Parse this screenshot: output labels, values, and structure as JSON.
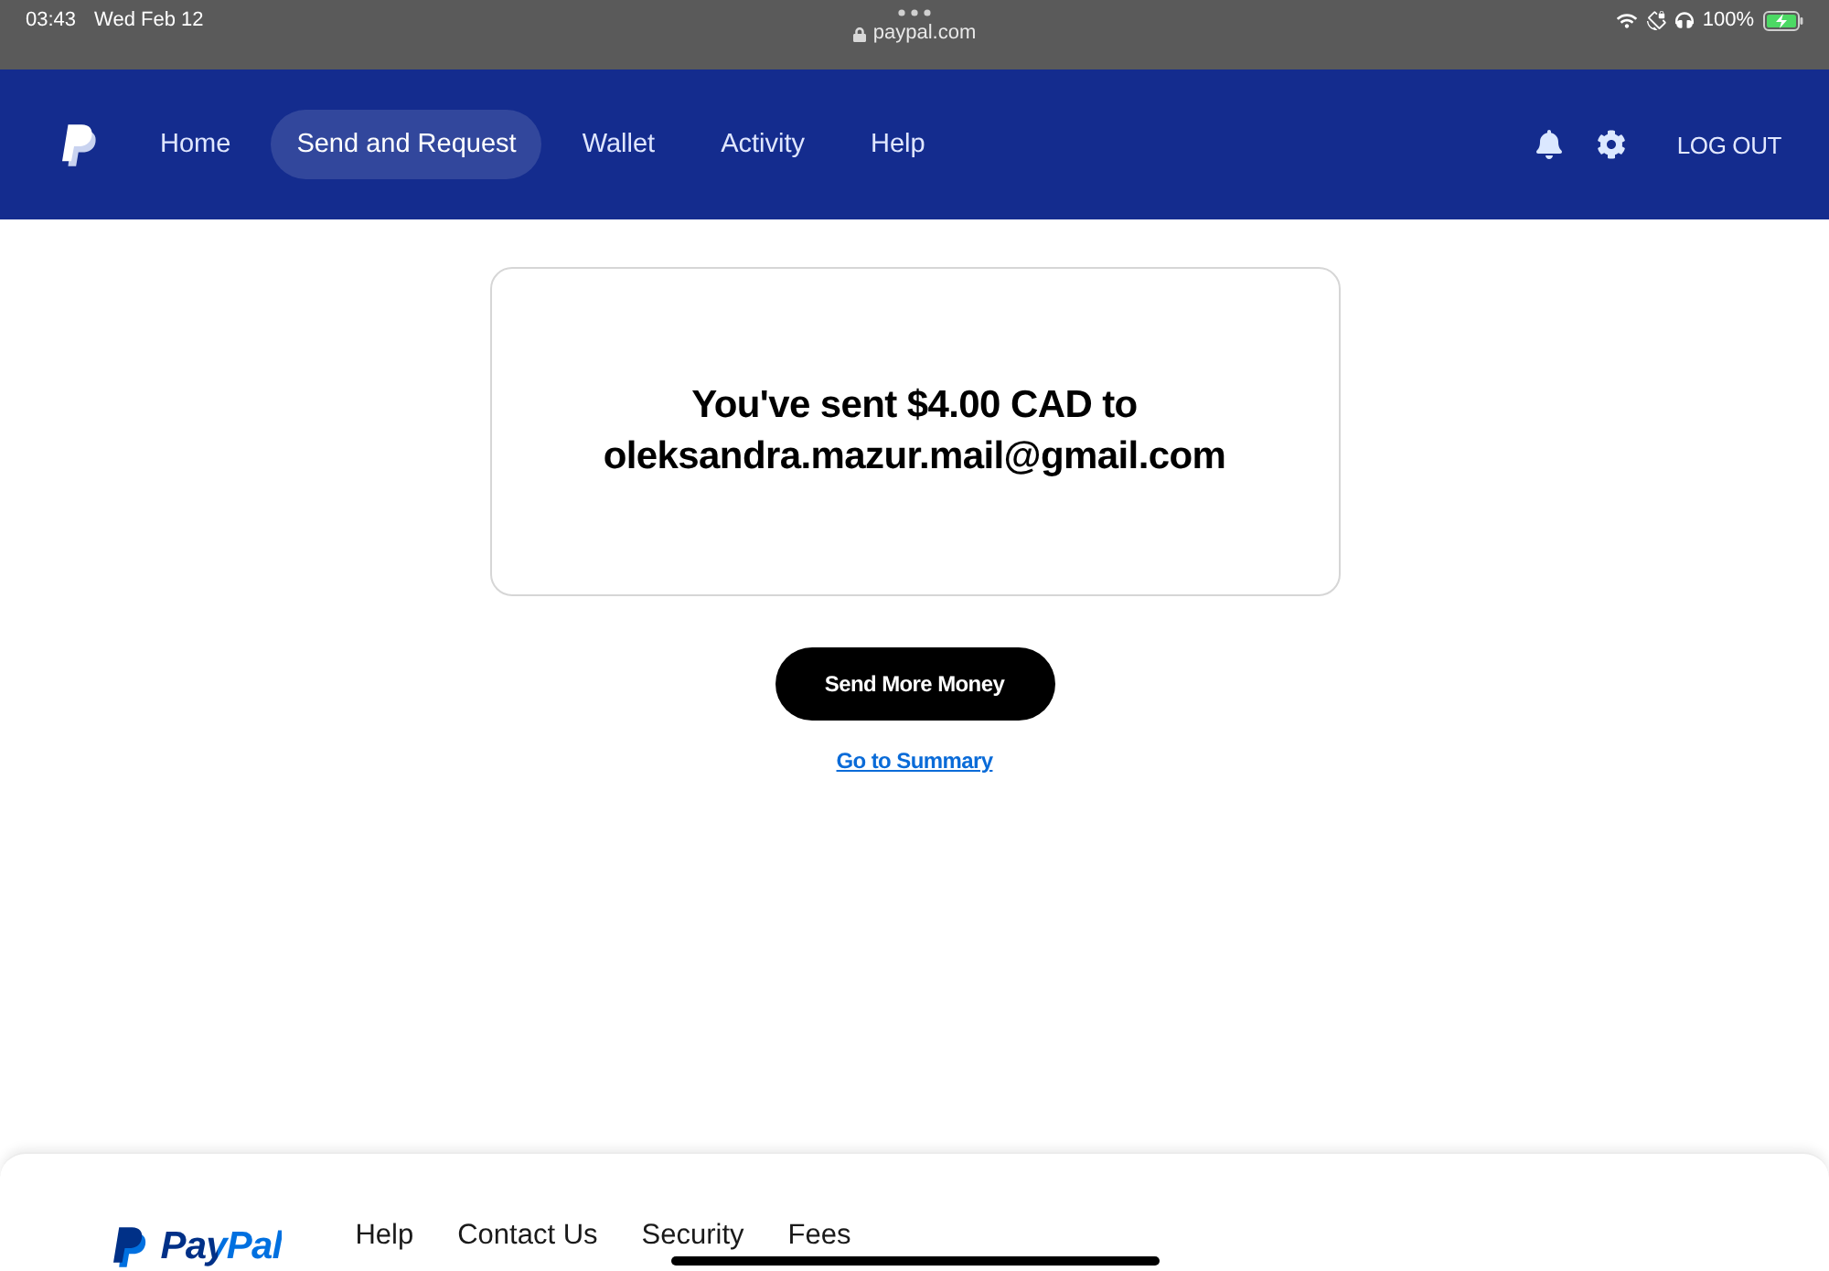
{
  "status_bar": {
    "time": "03:43",
    "date": "Wed Feb 12",
    "url": "paypal.com",
    "battery": "100%"
  },
  "nav": {
    "items": [
      {
        "label": "Home",
        "selected": false
      },
      {
        "label": "Send and Request",
        "selected": true
      },
      {
        "label": "Wallet",
        "selected": false
      },
      {
        "label": "Activity",
        "selected": false
      },
      {
        "label": "Help",
        "selected": false
      }
    ],
    "logout": "LOG OUT"
  },
  "confirmation": {
    "message": "You've sent $4.00 CAD to oleksandra.mazur.mail@gmail.com"
  },
  "primary_button": "Send More Money",
  "summary_link": "Go to Summary",
  "footer": {
    "brand": "PayPal",
    "links": [
      "Help",
      "Contact Us",
      "Security",
      "Fees"
    ]
  }
}
